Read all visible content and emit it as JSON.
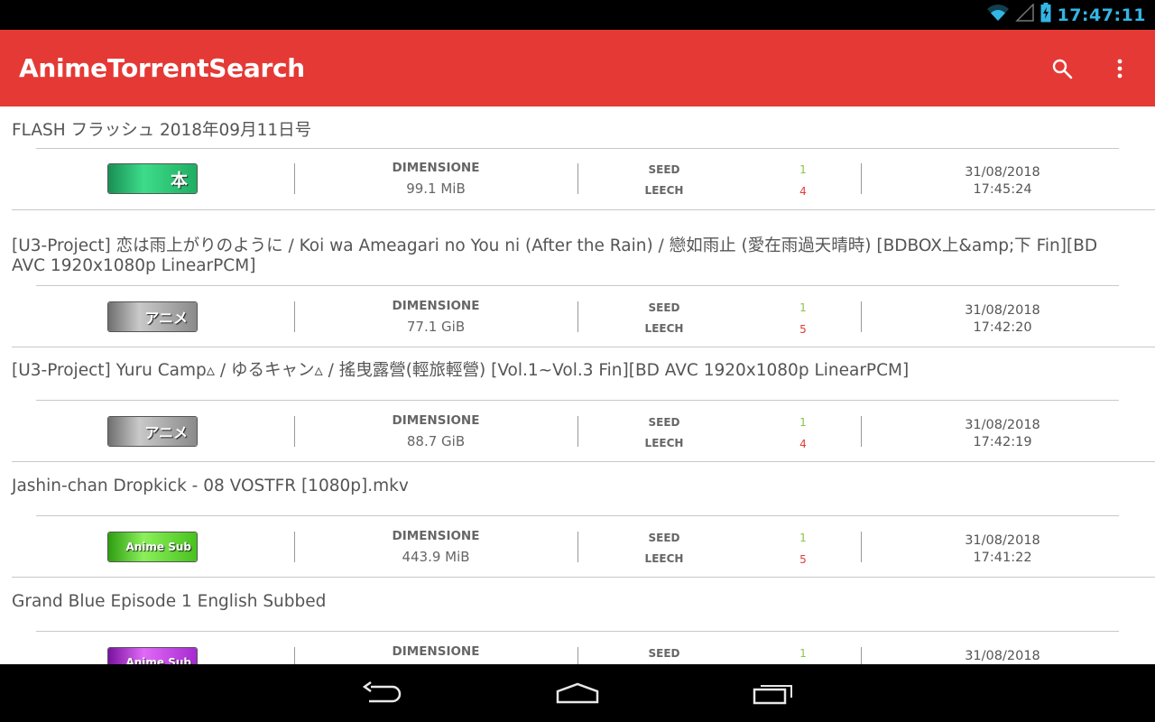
{
  "status_bar": {
    "time": "17:47:11",
    "icons": [
      "wifi-icon",
      "signal-icon",
      "battery-charging-icon"
    ],
    "accent": "#33b5e5"
  },
  "app_bar": {
    "title": "AnimeTorrentSearch",
    "color": "#e53935",
    "actions": [
      "search-icon",
      "more-vert-icon"
    ]
  },
  "labels": {
    "size": "DIMENSIONE",
    "seed": "SEED",
    "leech": "LEECH"
  },
  "items": [
    {
      "title": "FLASH フラッシュ 2018年09月11日号",
      "category_icon": "book-category-icon",
      "category_label": "本",
      "category_color": "#2bb673",
      "size": "99.1 MiB",
      "seed": "1",
      "leech": "4",
      "date": "31/08/2018",
      "time": "17:45:24"
    },
    {
      "title": "[U3-Project] 恋は雨上がりのように / Koi wa Ameagari no You ni (After the Rain) / 戀如雨止 (愛在雨過天晴時) [BDBOX上&amp;下 Fin][BD AVC 1920x1080p LinearPCM]",
      "category_icon": "anime-raw-category-icon",
      "category_label": "アニメ",
      "category_color": "#8a8a8a",
      "size": "77.1 GiB",
      "seed": "1",
      "leech": "5",
      "date": "31/08/2018",
      "time": "17:42:20"
    },
    {
      "title": "[U3-Project] Yuru Camp▵ / ゆるキャン▵ / 搖曳露營(輕旅輕營) [Vol.1~Vol.3 Fin][BD AVC 1920x1080p LinearPCM]",
      "category_icon": "anime-raw-category-icon",
      "category_label": "アニメ",
      "category_color": "#8a8a8a",
      "size": "88.7 GiB",
      "seed": "1",
      "leech": "4",
      "date": "31/08/2018",
      "time": "17:42:19"
    },
    {
      "title": "Jashin-chan Dropkick - 08 VOSTFR [1080p].mkv",
      "category_icon": "anime-sub-category-icon",
      "category_label": "Anime Sub",
      "category_color": "#5fd12a",
      "size": "443.9 MiB",
      "seed": "1",
      "leech": "5",
      "date": "31/08/2018",
      "time": "17:41:22"
    },
    {
      "title": "Grand Blue Episode 1 English Subbed",
      "category_icon": "anime-sub-category-icon",
      "category_label": "Anime Sub",
      "category_color": "#b32bd6",
      "size": "",
      "seed": "1",
      "leech": "",
      "date": "31/08/2018",
      "time": ""
    }
  ],
  "nav_bar": {
    "buttons": [
      "back-icon",
      "home-icon",
      "recent-apps-icon"
    ]
  }
}
